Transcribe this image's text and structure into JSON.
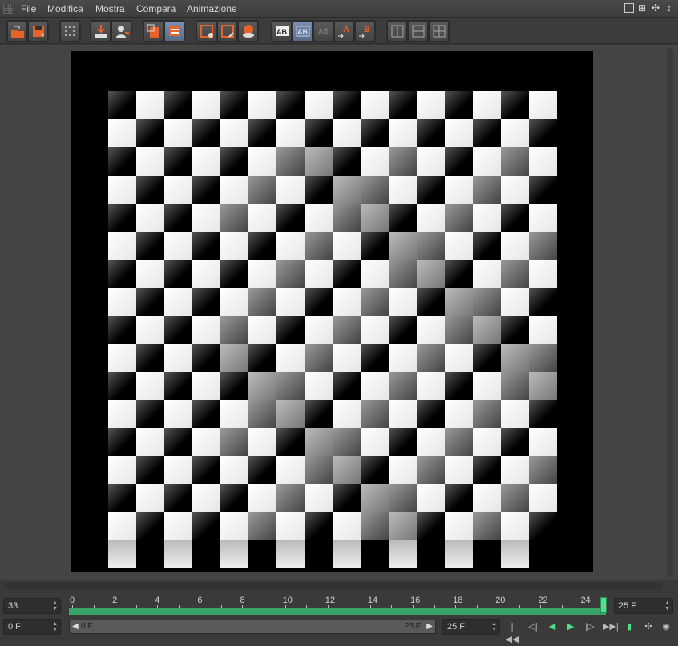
{
  "menu": {
    "items": [
      "File",
      "Modifica",
      "Mostra",
      "Compara",
      "Animazione"
    ]
  },
  "toolbar": {
    "groups": [
      [
        "open-icon",
        "save-icon"
      ],
      [
        "grid-icon"
      ],
      [
        "import-icon",
        "user-export-icon"
      ],
      [
        "layer-copy-icon",
        "render-active-icon"
      ],
      [
        "region-icon",
        "region-edit-icon",
        "region-view-icon"
      ],
      [
        "compare-ab-icon",
        "compare-ab-active-icon",
        "compare-ab-disabled-icon",
        "set-a-icon",
        "set-b-icon"
      ],
      [
        "split-horizontal-icon",
        "split-vertical-icon",
        "split-grid-icon"
      ]
    ],
    "labels": {
      "ab": "AB",
      "a": "A",
      "b": "B"
    }
  },
  "timeline": {
    "current_frame": "33",
    "end_field": "25 F",
    "ticks": [
      "0",
      "2",
      "4",
      "6",
      "8",
      "10",
      "12",
      "14",
      "16",
      "18",
      "20",
      "22",
      "24"
    ]
  },
  "bottom": {
    "start_field": "0 F",
    "range_start": "0 F",
    "range_end": "25 F",
    "end_field": "25 F"
  },
  "colors": {
    "accent": "#4fe08a",
    "track": "#3aa36a",
    "active_button": "#6b7fa2",
    "orange_icon": "#e8622a"
  }
}
